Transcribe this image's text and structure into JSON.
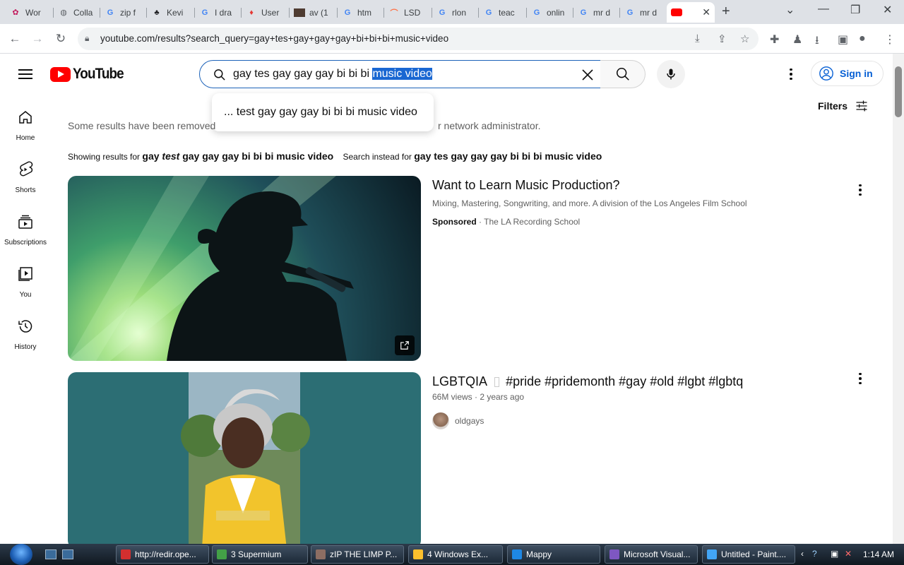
{
  "browser": {
    "tabs": [
      {
        "label": "Wor",
        "icon": "flower-icon",
        "color": "#c2185b"
      },
      {
        "label": "Colla",
        "icon": "globe-icon",
        "color": "#5f6368"
      },
      {
        "label": "zip f",
        "icon": "google-icon",
        "color": "#4285f4"
      },
      {
        "label": "Kevi",
        "icon": "figure-icon",
        "color": "#202124"
      },
      {
        "label": "I dra",
        "icon": "google-icon",
        "color": "#4285f4"
      },
      {
        "label": "User",
        "icon": "fire-icon",
        "color": "#e53935"
      },
      {
        "label": "av (1",
        "icon": "thumbnail-icon",
        "color": "#6d4c41"
      },
      {
        "label": "htm",
        "icon": "google-icon",
        "color": "#4285f4"
      },
      {
        "label": "LSD",
        "icon": "rainbow-icon",
        "color": "#ff7043"
      },
      {
        "label": "rlon",
        "icon": "google-icon",
        "color": "#4285f4"
      },
      {
        "label": "teac",
        "icon": "google-icon",
        "color": "#4285f4"
      },
      {
        "label": "onlin",
        "icon": "google-icon",
        "color": "#4285f4"
      },
      {
        "label": "mr d",
        "icon": "google-icon",
        "color": "#4285f4"
      },
      {
        "label": "mr d",
        "icon": "google-icon",
        "color": "#4285f4"
      },
      {
        "label": "",
        "icon": "youtube-icon",
        "color": "#ff0000",
        "active": true
      }
    ],
    "url": "youtube.com/results?search_query=gay+tes+gay+gay+gay+bi+bi+bi+music+video"
  },
  "header": {
    "logo_text": "YouTube",
    "search": {
      "query_before": "gay tes gay gay gay bi bi bi ",
      "query_selected": "music video"
    },
    "sign_in_label": "Sign in"
  },
  "suggestion": {
    "text": "... test gay gay gay bi bi bi music video"
  },
  "guide": [
    {
      "label": "Home",
      "icon": "home-icon"
    },
    {
      "label": "Shorts",
      "icon": "shorts-icon"
    },
    {
      "label": "Subscriptions",
      "icon": "subscriptions-icon"
    },
    {
      "label": "You",
      "icon": "you-icon"
    },
    {
      "label": "History",
      "icon": "history-icon"
    }
  ],
  "results_header": {
    "filters_label": "Filters",
    "removed_left": "Some results have been removed",
    "removed_right": "r network administrator.",
    "showing_prefix": "Showing results for",
    "showing_q1": "gay ",
    "showing_q_corrected": "test",
    "showing_q2": " gay gay gay bi bi bi music video",
    "instead_prefix": "Search instead for",
    "instead_query": "gay tes gay gay gay bi bi bi music video"
  },
  "results": [
    {
      "title": "Want to Learn Music Production?",
      "description": "Mixing, Mastering, Songwriting, and more. A division of the Los Angeles Film School",
      "sponsored_label": "Sponsored",
      "channel": "The LA Recording School"
    },
    {
      "title": "LGBTQIA",
      "hashtags": "#pride #pridemonth #gay #old #lgbt #lgbtq",
      "views": "66M views",
      "age": "2 years ago",
      "channel": "oldgays"
    }
  ],
  "taskbar": {
    "buttons": [
      {
        "label": "http://redir.ope...",
        "color": "#d32f2f"
      },
      {
        "label": "3 Supermium",
        "color": "#43a047"
      },
      {
        "label": "zIP THE LIMP P...",
        "color": "#8d6e63"
      },
      {
        "label": "4 Windows Ex...",
        "color": "#fbc02d"
      },
      {
        "label": "Mappy",
        "color": "#1e88e5"
      },
      {
        "label": "Microsoft Visual...",
        "color": "#7e57c2"
      },
      {
        "label": "Untitled - Paint....",
        "color": "#42a5f5"
      }
    ],
    "time": "1:14 AM"
  }
}
